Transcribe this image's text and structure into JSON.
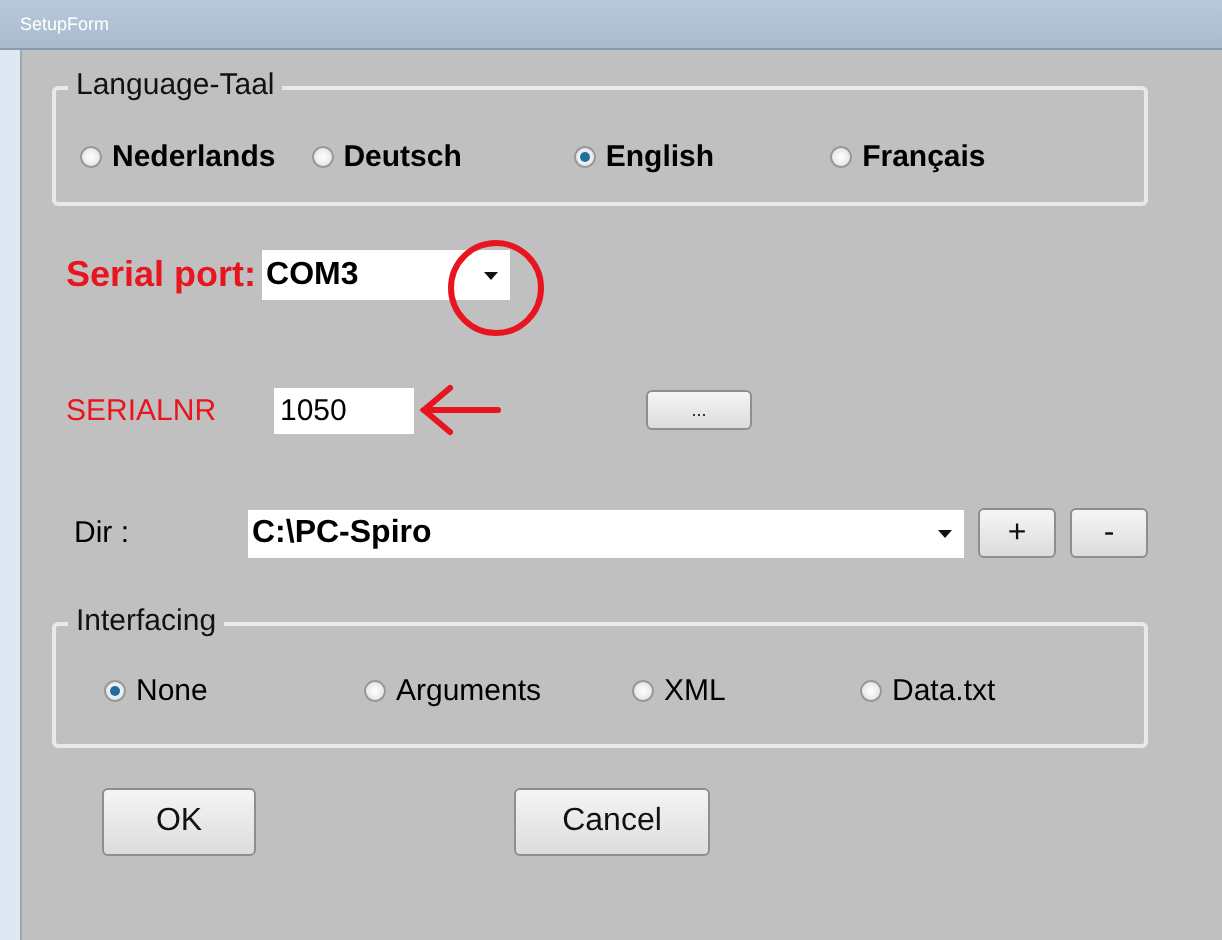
{
  "window": {
    "title": "SetupForm"
  },
  "language": {
    "legend": "Language-Taal",
    "options": [
      {
        "label": "Nederlands",
        "selected": false
      },
      {
        "label": "Deutsch",
        "selected": false
      },
      {
        "label": "English",
        "selected": true
      },
      {
        "label": "Français",
        "selected": false
      }
    ]
  },
  "serial_port": {
    "label": "Serial port:",
    "value": "COM3"
  },
  "serialnr": {
    "label": "SERIALNR",
    "value": "1050",
    "button": "..."
  },
  "dir": {
    "label": "Dir :",
    "value": "C:\\PC-Spiro",
    "buttons": [
      "+",
      "-"
    ]
  },
  "interfacing": {
    "legend": "Interfacing",
    "options": [
      {
        "label": "None",
        "selected": true
      },
      {
        "label": "Arguments",
        "selected": false
      },
      {
        "label": "XML",
        "selected": false
      },
      {
        "label": "Data.txt",
        "selected": false
      }
    ]
  },
  "buttons": [
    "OK",
    "Cancel"
  ]
}
